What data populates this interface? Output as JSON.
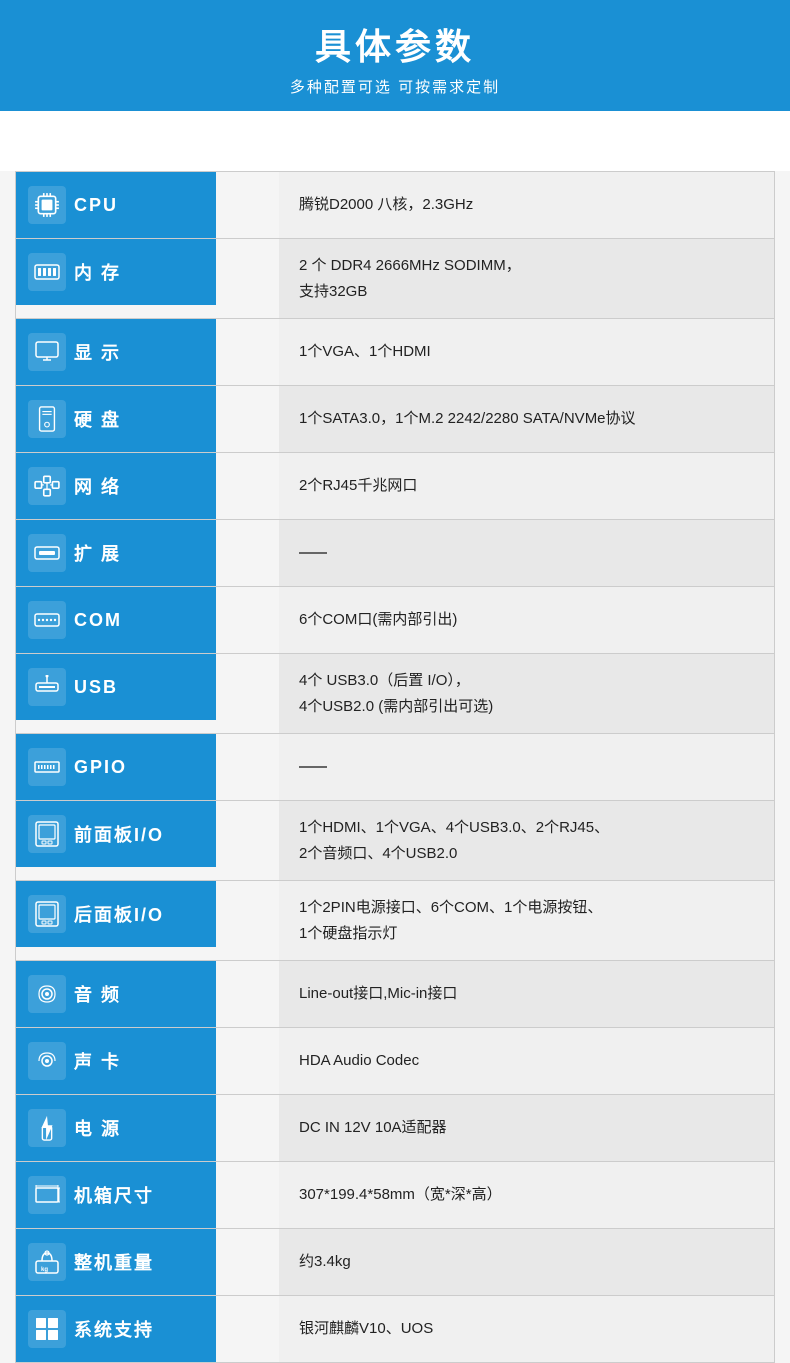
{
  "header": {
    "title": "具体参数",
    "subtitle": "多种配置可选 可按需求定制"
  },
  "rows": [
    {
      "id": "cpu",
      "icon": "🖥",
      "label": "CPU",
      "value": "腾锐D2000 八核，2.3GHz"
    },
    {
      "id": "memory",
      "icon": "🗂",
      "label": "内 存",
      "value": "2 个 DDR4 2666MHz SODIMM，\n支持32GB"
    },
    {
      "id": "display",
      "icon": "🖵",
      "label": "显 示",
      "value": "1个VGA、1个HDMI"
    },
    {
      "id": "disk",
      "icon": "💾",
      "label": "硬 盘",
      "value": "1个SATA3.0，1个M.2 2242/2280 SATA/NVMe协议"
    },
    {
      "id": "network",
      "icon": "🌐",
      "label": "网 络",
      "value": "2个RJ45千兆网口"
    },
    {
      "id": "expansion",
      "icon": "📡",
      "label": "扩 展",
      "value": "—"
    },
    {
      "id": "com",
      "icon": "🔌",
      "label": "COM",
      "value": "6个COM口(需内部引出)"
    },
    {
      "id": "usb",
      "icon": "⬛",
      "label": "USB",
      "value": "4个 USB3.0（后置 I/O），\n4个USB2.0 (需内部引出可选)"
    },
    {
      "id": "gpio",
      "icon": "🔧",
      "label": "GPIO",
      "value": "—"
    },
    {
      "id": "front-io",
      "icon": "⬜",
      "label": "前面板I/O",
      "value": "1个HDMI、1个VGA、4个USB3.0、2个RJ45、\n2个音频口、4个USB2.0"
    },
    {
      "id": "rear-io",
      "icon": "⬜",
      "label": "后面板I/O",
      "value": "1个2PIN电源接口、6个COM、1个电源按钮、\n1个硬盘指示灯"
    },
    {
      "id": "audio",
      "icon": "🔊",
      "label": "音 频",
      "value": "Line-out接口,Mic-in接口"
    },
    {
      "id": "sound-card",
      "icon": "🔊",
      "label": "声 卡",
      "value": "HDA Audio Codec"
    },
    {
      "id": "power",
      "icon": "⚡",
      "label": "电 源",
      "value": "DC IN 12V 10A适配器"
    },
    {
      "id": "dimension",
      "icon": "📐",
      "label": "机箱尺寸",
      "value": "307*199.4*58mm（宽*深*高）"
    },
    {
      "id": "weight",
      "icon": "⚖",
      "label": "整机重量",
      "value": "约3.4kg"
    },
    {
      "id": "os",
      "icon": "🪟",
      "label": "系统支持",
      "value": "银河麒麟V10、UOS"
    }
  ]
}
